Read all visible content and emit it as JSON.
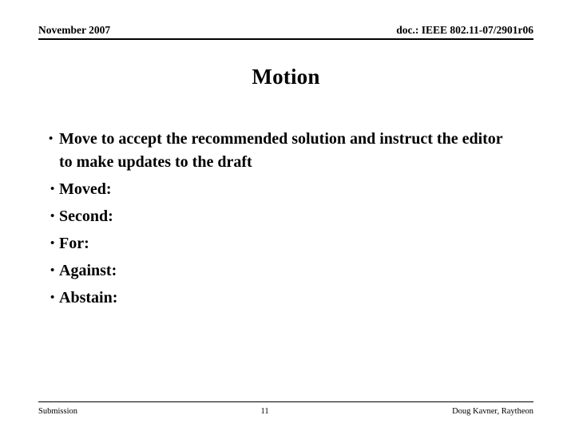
{
  "header": {
    "date": "November 2007",
    "doc_number": "doc.: IEEE 802.11-07/2901r06"
  },
  "title": "Motion",
  "body": {
    "bullet_marker": "•",
    "items": [
      {
        "level": 1,
        "text": "Move to accept the recommended solution and instruct the editor to make updates to the draft"
      },
      {
        "level": 2,
        "text": "Moved:"
      },
      {
        "level": 2,
        "text": "Second:"
      },
      {
        "level": 2,
        "text": "For:"
      },
      {
        "level": 2,
        "text": "Against:"
      },
      {
        "level": 2,
        "text": "Abstain:"
      }
    ]
  },
  "footer": {
    "left": "Submission",
    "page_number": "11",
    "right": "Doug Kavner, Raytheon"
  }
}
